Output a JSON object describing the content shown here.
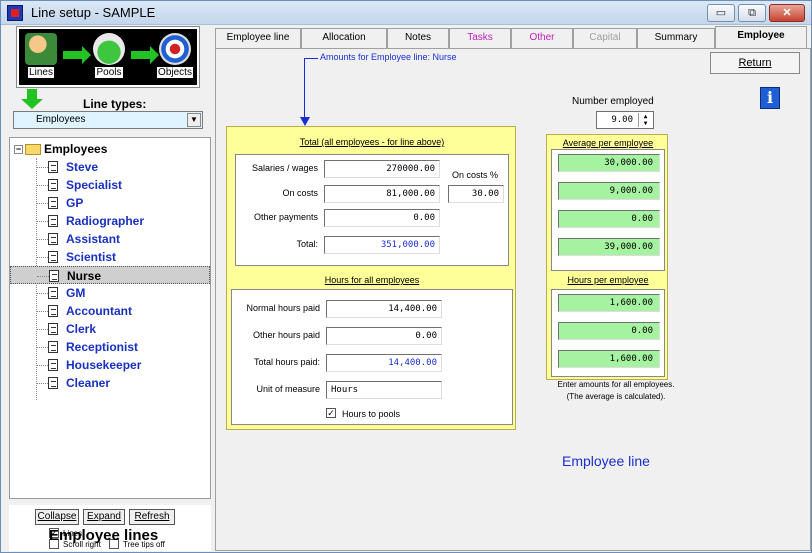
{
  "window": {
    "title": "Line setup - SAMPLE",
    "btn_min": "▭",
    "btn_max": "⧉",
    "btn_close": "✕"
  },
  "flow": {
    "lines": "Lines",
    "pools": "Pools",
    "objects": "Objects"
  },
  "line_types": {
    "label": "Line types:",
    "selected": "Employees"
  },
  "tree": {
    "root": "Employees",
    "items": [
      "Steve",
      "Specialist",
      "GP",
      "Radiographer",
      "Assistant",
      "Scientist",
      "Nurse",
      "GM",
      "Accountant",
      "Clerk",
      "Receptionist",
      "Housekeeper",
      "Cleaner"
    ],
    "selected": "Nurse"
  },
  "tree_buttons": {
    "collapse": "Collapse",
    "expand": "Expand",
    "refresh": "Refresh"
  },
  "options": {
    "lines": "Lines",
    "lines_checked": "✓",
    "scroll_right": "Scroll right",
    "tree_tips_off": "Tree tips off"
  },
  "footer_label": "Employee lines",
  "tabs": [
    {
      "label": "Employee line",
      "style": "normal"
    },
    {
      "label": "Allocation",
      "style": "normal"
    },
    {
      "label": "Notes",
      "style": "normal"
    },
    {
      "label": "Tasks",
      "style": "magenta"
    },
    {
      "label": "Other",
      "style": "magenta"
    },
    {
      "label": "Capital",
      "style": "disabled"
    },
    {
      "label": "Summary",
      "style": "normal"
    },
    {
      "label": "Employee",
      "style": "active"
    }
  ],
  "return_button": "Return",
  "info_icon": "i",
  "amounts_label": "Amounts for Employee line: Nurse",
  "total_section": {
    "title": "Total (all employees - for line above)",
    "salaries_label": "Salaries / wages",
    "salaries": "270000.00",
    "on_costs_label": "On costs",
    "on_costs": "81,000.00",
    "on_costs_pct_label": "On costs %",
    "on_costs_pct": "30.00",
    "other_label": "Other payments",
    "other": "0.00",
    "total_label": "Total:",
    "total": "351,000.00"
  },
  "hours_section": {
    "title": "Hours for all employees",
    "normal_label": "Normal hours paid",
    "normal": "14,400.00",
    "other_label": "Other hours paid",
    "other": "0.00",
    "total_label": "Total hours paid:",
    "total": "14,400.00",
    "unit_label": "Unit of measure",
    "unit": "Hours",
    "to_pools_label": "Hours to pools",
    "to_pools_checked": "✓"
  },
  "number_employed": {
    "label": "Number employed",
    "value": "9.00",
    "up": "▲",
    "down": "▼"
  },
  "average": {
    "title": "Average per employee",
    "values": [
      "30,000.00",
      "9,000.00",
      "0.00",
      "39,000.00"
    ]
  },
  "hours_per": {
    "title": "Hours per employee",
    "values": [
      "1,600.00",
      "0.00",
      "1,600.00"
    ]
  },
  "note": {
    "line1": "Enter amounts for all employees.",
    "line2": "(The average is calculated)."
  },
  "employee_line_label": "Employee line"
}
